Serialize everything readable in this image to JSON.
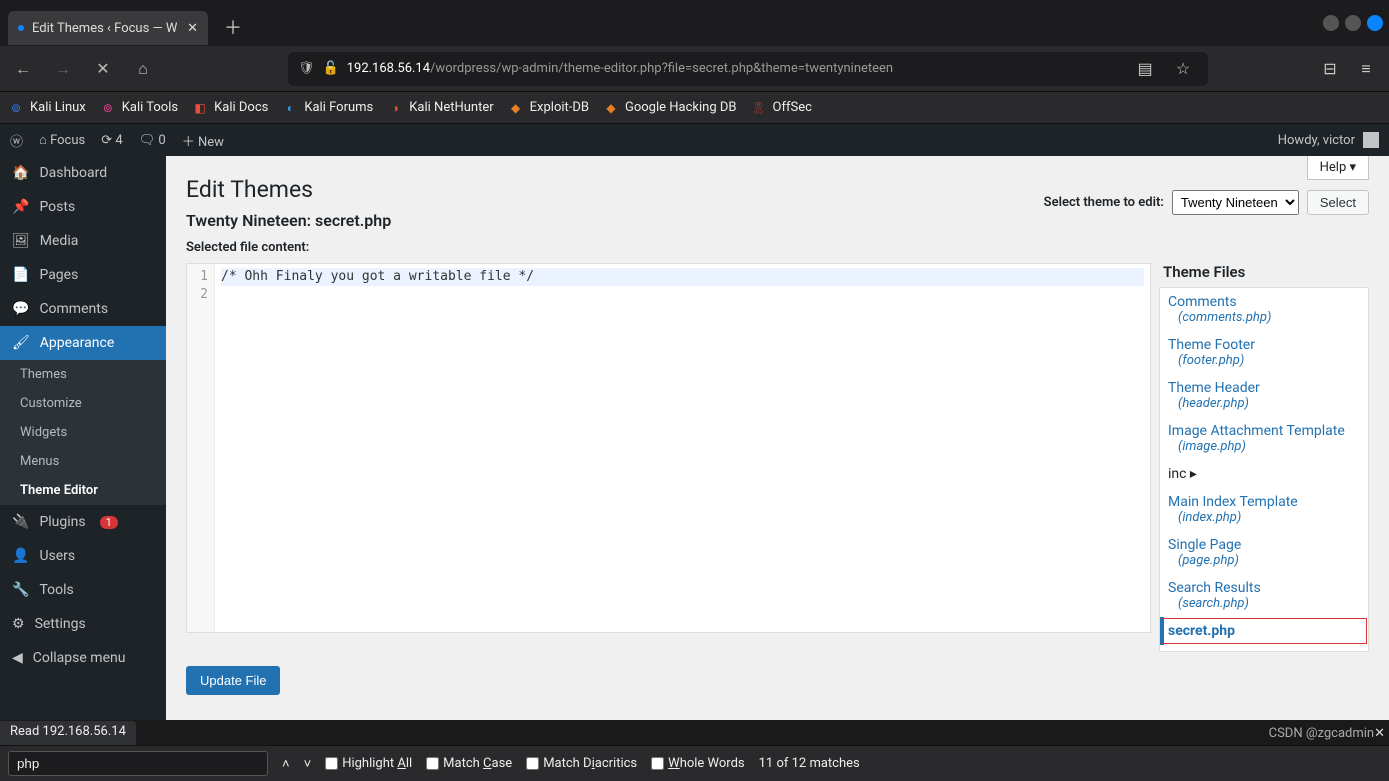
{
  "browser": {
    "tab_title": "Edit Themes ‹ Focus — W",
    "url_host": "192.168.56.14",
    "url_rest": "/wordpress/wp-admin/theme-editor.php?file=secret.php&theme=twentynineteen",
    "bookmarks": [
      "Kali Linux",
      "Kali Tools",
      "Kali Docs",
      "Kali Forums",
      "Kali NetHunter",
      "Exploit-DB",
      "Google Hacking DB",
      "OffSec"
    ]
  },
  "adminbar": {
    "site": "Focus",
    "updates": "4",
    "comments": "0",
    "new": "New",
    "howdy": "Howdy, victor"
  },
  "sidebar": {
    "dashboard": "Dashboard",
    "posts": "Posts",
    "media": "Media",
    "pages": "Pages",
    "comments": "Comments",
    "appearance": "Appearance",
    "submenu": {
      "themes": "Themes",
      "customize": "Customize",
      "widgets": "Widgets",
      "menus": "Menus",
      "editor": "Theme Editor"
    },
    "plugins": "Plugins",
    "plugins_badge": "1",
    "users": "Users",
    "tools": "Tools",
    "settings": "Settings",
    "collapse": "Collapse menu"
  },
  "page": {
    "help": "Help ▾",
    "title": "Edit Themes",
    "subtitle": "Twenty Nineteen: secret.php",
    "selected_label": "Selected file content:",
    "select_theme_label": "Select theme to edit:",
    "select_value": "Twenty Nineteen",
    "select_btn": "Select",
    "update_btn": "Update File",
    "theme_files_heading": "Theme Files",
    "code_line1": "/* Ohh Finaly you got a writable file */",
    "files": [
      {
        "label": "Comments",
        "fn": "(comments.php)"
      },
      {
        "label": "Theme Footer",
        "fn": "(footer.php)"
      },
      {
        "label": "Theme Header",
        "fn": "(header.php)"
      },
      {
        "label": "Image Attachment Template",
        "fn": "(image.php)"
      },
      {
        "label": "inc ▸",
        "folder": true
      },
      {
        "label": "Main Index Template",
        "fn": "(index.php)"
      },
      {
        "label": "Single Page",
        "fn": "(page.php)"
      },
      {
        "label": "Search Results",
        "fn": "(search.php)"
      },
      {
        "label": "secret.php",
        "selected": true
      }
    ]
  },
  "status": "Read 192.168.56.14",
  "findbar": {
    "value": "php",
    "highlight": "Highlight All",
    "matchcase": "Match Case",
    "diacritics": "Match Diacritics",
    "whole": "Whole Words",
    "count": "11 of 12 matches"
  },
  "watermark": "CSDN @zgcadmin"
}
